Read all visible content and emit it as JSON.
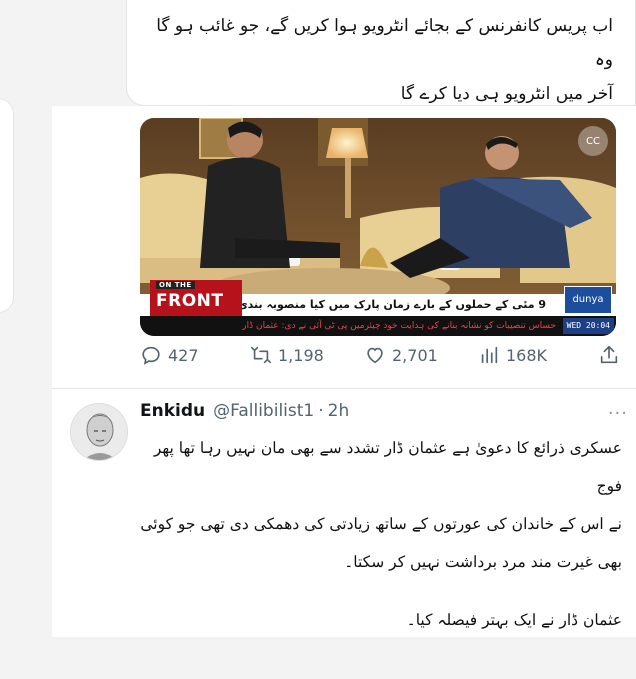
{
  "quote_tweet": {
    "lines": [
      "اب پریس کانفرنس کے بجائے انٹرویو ہوا کریں گے، جو غائب ہو گا وہ",
      "آخر میں انٹرویو ہی دیا کرے گا"
    ]
  },
  "media": {
    "show_badge_small": "ON THE",
    "show_badge_big": "FRONT",
    "headline": "9 مئی کے حملوں کے بارے زمان پارک میں کیا منصوبہ بندی ہوئی؟",
    "ticker": "حساس تنصیبات کو نشانہ بنانے کی ہدایت خود چیئرمین پی ٹی آئی نے دی: عثمان ڈار",
    "timestamp": "WED 20:04",
    "cc_label": "CC",
    "channel_logo": "dunya"
  },
  "actions": {
    "replies": "427",
    "retweets": "1,198",
    "likes": "2,701",
    "views": "168K"
  },
  "reply_tweet": {
    "author_name": "Enkidu",
    "author_handle": "@Fallibilist1",
    "separator": "·",
    "time": "2h",
    "more": "···",
    "paragraphs": [
      "عسکری ذرائع کا دعویٰ ہے عثمان ڈار تشدد سے بھی مان نہیں رہا تھا پھر فوج",
      "نے اس کے خاندان کی عورتوں کے ساتھ زیادتی کی دھمکی دی تھی جو کوئی",
      "بھی غیرت مند مرد برداشت نہیں کر سکتا۔",
      "عثمان ڈار نے ایک بہتر فیصلہ کیا۔"
    ]
  },
  "colors": {
    "muted": "#536471",
    "badge_red": "#b5121b",
    "ticker_red": "#e3454b"
  }
}
